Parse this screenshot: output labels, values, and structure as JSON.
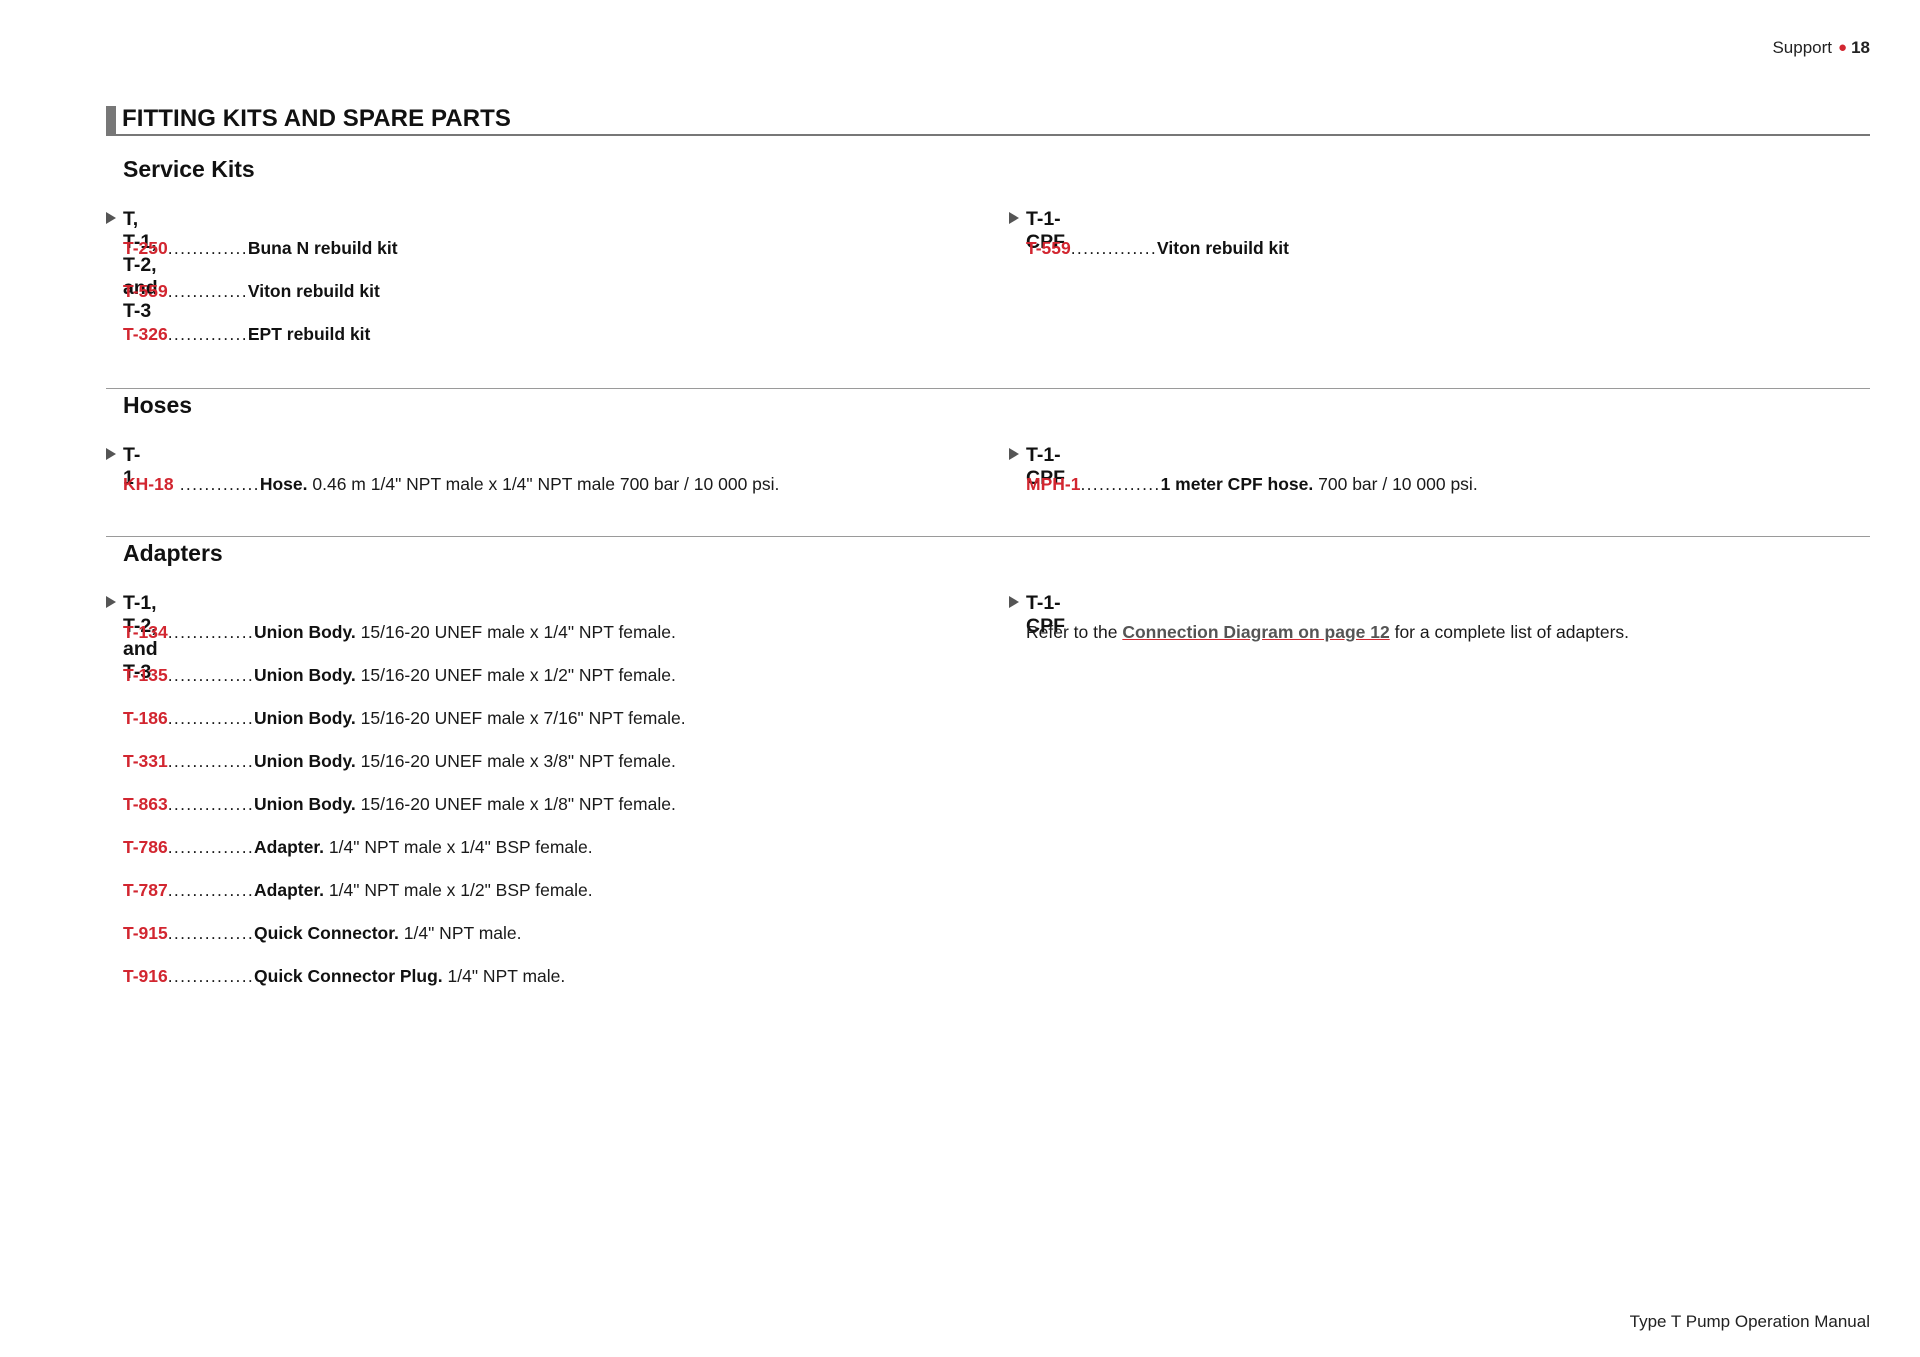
{
  "header": {
    "section": "Support",
    "page_number": "18"
  },
  "page_title": "FITTING KITS AND SPARE PARTS",
  "service_kits": {
    "title": "Service Kits",
    "left": {
      "heading": "T, T-1, T-2, and T-3",
      "items": [
        {
          "part": "T-250",
          "dots": ".............",
          "bold": "Buna N rebuild kit",
          "desc": ""
        },
        {
          "part": "T-559",
          "dots": ".............",
          "bold": "Viton rebuild kit",
          "desc": ""
        },
        {
          "part": "T-326",
          "dots": ".............",
          "bold": "EPT rebuild kit",
          "desc": ""
        }
      ]
    },
    "right": {
      "heading": "T-1-CPF",
      "items": [
        {
          "part": "T-559",
          "dots": "..............",
          "bold": "Viton rebuild kit",
          "desc": ""
        }
      ]
    }
  },
  "hoses": {
    "title": "Hoses",
    "left": {
      "heading": "T-1",
      "items": [
        {
          "part": "KH-18",
          "dots": " .............",
          "bold": "Hose.",
          "desc": " 0.46 m 1/4\" NPT male x 1/4\" NPT male 700 bar / 10 000 psi."
        }
      ]
    },
    "right": {
      "heading": "T-1-CPF",
      "items": [
        {
          "part": "MPH-1",
          "dots": ".............",
          "bold": "1 meter CPF hose.",
          "desc": " 700 bar / 10 000 psi."
        }
      ]
    }
  },
  "adapters": {
    "title": "Adapters",
    "left": {
      "heading": "T-1, T-2, and T-3",
      "items": [
        {
          "part": "T-134",
          "dots": "..............",
          "bold": "Union Body.",
          "desc": " 15/16-20 UNEF male x 1/4\" NPT female."
        },
        {
          "part": "T-135",
          "dots": "..............",
          "bold": "Union Body.",
          "desc": " 15/16-20 UNEF male x 1/2\" NPT female."
        },
        {
          "part": "T-186",
          "dots": "..............",
          "bold": "Union Body.",
          "desc": " 15/16-20 UNEF male x 7/16\" NPT female."
        },
        {
          "part": "T-331",
          "dots": "..............",
          "bold": "Union Body.",
          "desc": " 15/16-20 UNEF male x 3/8\" NPT female."
        },
        {
          "part": "T-863",
          "dots": "..............",
          "bold": "Union Body.",
          "desc": " 15/16-20 UNEF male x 1/8\" NPT female."
        },
        {
          "part": "T-786",
          "dots": "..............",
          "bold": "Adapter.",
          "desc": " 1/4\" NPT male x 1/4\" BSP female."
        },
        {
          "part": "T-787",
          "dots": "..............",
          "bold": "Adapter.",
          "desc": " 1/4\" NPT male x 1/2\" BSP female."
        },
        {
          "part": "T-915",
          "dots": "..............",
          "bold": "Quick Connector.",
          "desc": " 1/4\" NPT male."
        },
        {
          "part": "T-916",
          "dots": "..............",
          "bold": "Quick Connector Plug.",
          "desc": " 1/4\" NPT male."
        }
      ]
    },
    "right": {
      "heading": "T-1-CPF",
      "note_prefix": "Refer to the ",
      "note_link": "Connection Diagram on page 12",
      "note_suffix": " for a complete list of adapters."
    }
  },
  "footer": "Type T Pump Operation Manual",
  "colors": {
    "part_number": "#d22630",
    "rule": "#9a9a9a",
    "heading_bar": "#777777"
  }
}
